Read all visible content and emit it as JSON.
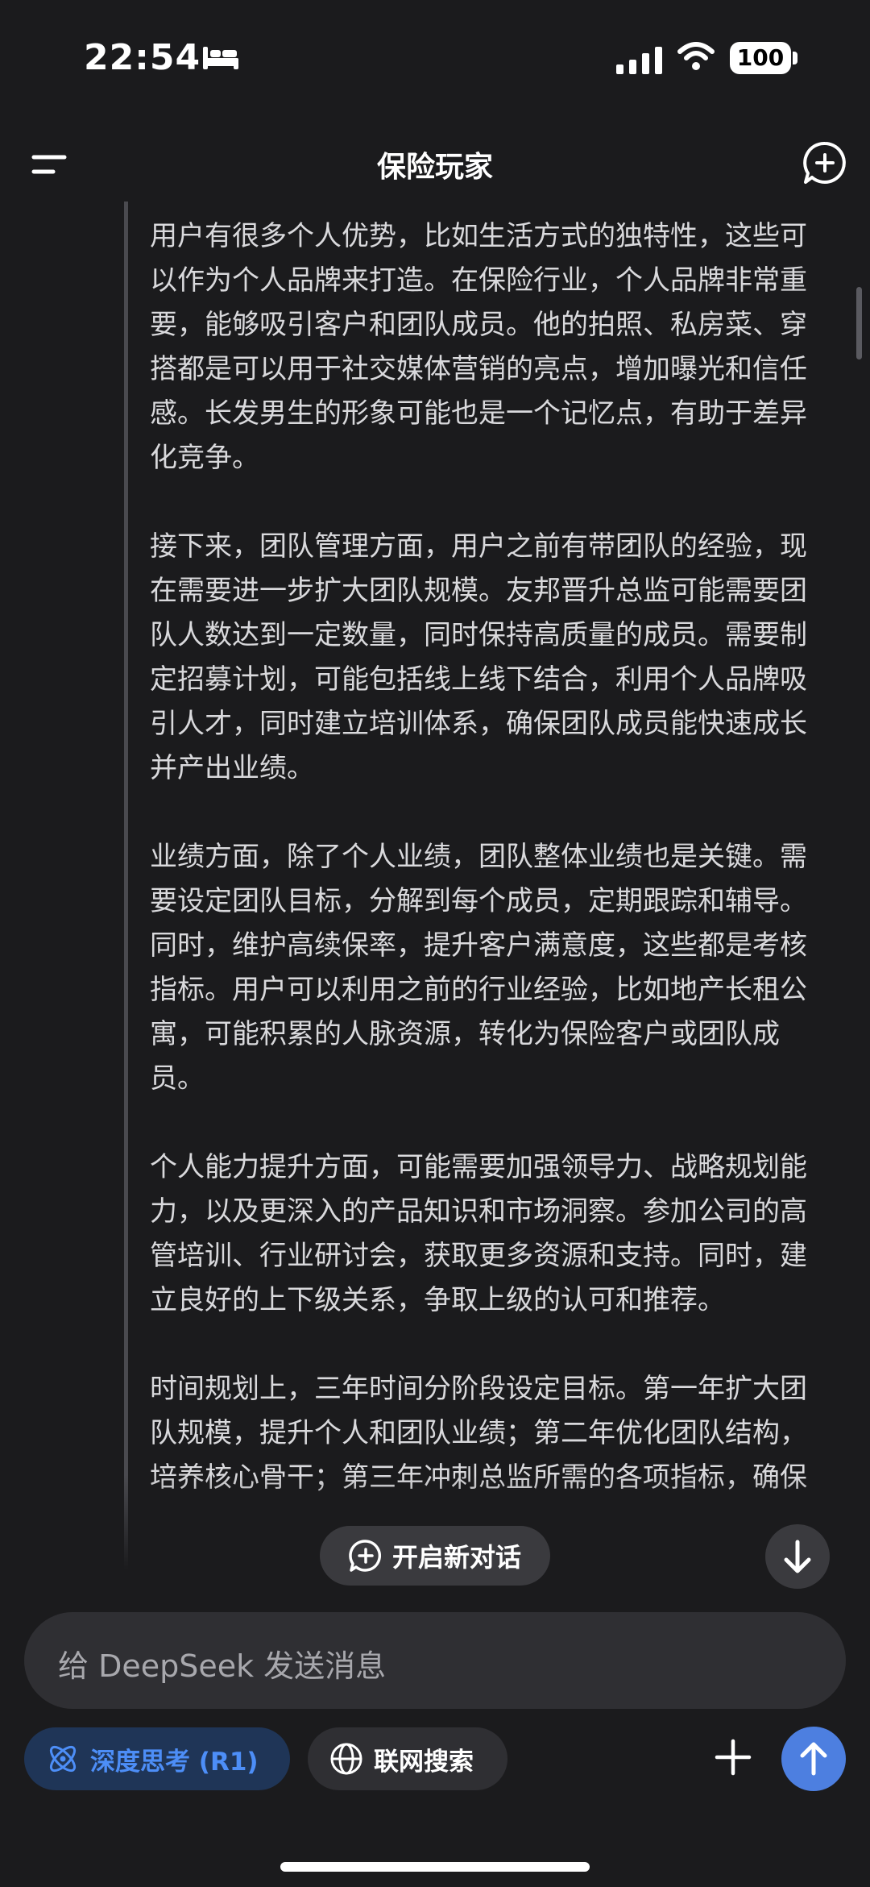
{
  "status_bar": {
    "time": "22:54",
    "battery": "100"
  },
  "header": {
    "title": "保险玩家"
  },
  "content": {
    "paragraphs": [
      "用户有很多个人优势，比如生活方式的独特性，这些可以作为个人品牌来打造。在保险行业，个人品牌非常重要，能够吸引客户和团队成员。他的拍照、私房菜、穿搭都是可以用于社交媒体营销的亮点，增加曝光和信任感。长发男生的形象可能也是一个记忆点，有助于差异化竞争。",
      "接下来，团队管理方面，用户之前有带团队的经验，现在需要进一步扩大团队规模。友邦晋升总监可能需要团队人数达到一定数量，同时保持高质量的成员。需要制定招募计划，可能包括线上线下结合，利用个人品牌吸引人才，同时建立培训体系，确保团队成员能快速成长并产出业绩。",
      "业绩方面，除了个人业绩，团队整体业绩也是关键。需要设定团队目标，分解到每个成员，定期跟踪和辅导。同时，维护高续保率，提升客户满意度，这些都是考核指标。用户可以利用之前的行业经验，比如地产长租公寓，可能积累的人脉资源，转化为保险客户或团队成员。",
      "个人能力提升方面，可能需要加强领导力、战略规划能力，以及更深入的产品知识和市场洞察。参加公司的高管培训、行业研讨会，获取更多资源和支持。同时，建立良好的上下级关系，争取上级的认可和推荐。",
      "时间规划上，三年时间分阶段设定目标。第一年扩大团队规模，提升个人和团队业绩；第二年优化团队结构，培养核心骨干；第三年冲刺总监所需的各项指标，确保"
    ]
  },
  "actions": {
    "new_dialog": "开启新对话"
  },
  "input": {
    "placeholder": "给 DeepSeek 发送消息"
  },
  "toolbar": {
    "deep_think": "深度思考 (R1)",
    "web_search": "联网搜索"
  },
  "colors": {
    "background": "#1b1b1d",
    "accent": "#4d7fe0",
    "deep_think_text": "#4d8ef7"
  },
  "icons": [
    "bed-icon",
    "signal-icon",
    "wifi-icon",
    "menu-icon",
    "new-chat-icon",
    "chat-plus-icon",
    "arrow-down-icon",
    "atom-icon",
    "globe-icon",
    "plus-icon",
    "arrow-up-icon"
  ]
}
